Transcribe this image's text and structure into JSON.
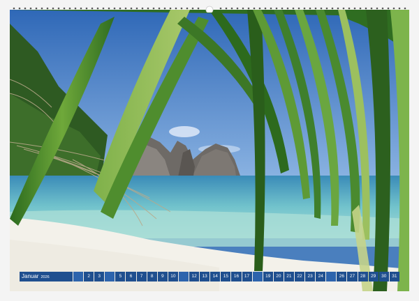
{
  "calendar": {
    "month": "Januar",
    "year": "2026",
    "days": [
      {
        "n": "",
        "we": true
      },
      {
        "n": "2"
      },
      {
        "n": "3"
      },
      {
        "n": "",
        "we": true
      },
      {
        "n": "5"
      },
      {
        "n": "6"
      },
      {
        "n": "7"
      },
      {
        "n": "8"
      },
      {
        "n": "9"
      },
      {
        "n": "10"
      },
      {
        "n": "",
        "we": true
      },
      {
        "n": "12"
      },
      {
        "n": "13"
      },
      {
        "n": "14"
      },
      {
        "n": "15"
      },
      {
        "n": "16"
      },
      {
        "n": "17"
      },
      {
        "n": "",
        "we": true
      },
      {
        "n": "19"
      },
      {
        "n": "20"
      },
      {
        "n": "21"
      },
      {
        "n": "22"
      },
      {
        "n": "23"
      },
      {
        "n": "24"
      },
      {
        "n": "",
        "we": true
      },
      {
        "n": "26"
      },
      {
        "n": "27"
      },
      {
        "n": "28"
      },
      {
        "n": "29"
      },
      {
        "n": "30"
      },
      {
        "n": "31"
      }
    ]
  },
  "colors": {
    "strip": "#1f4f8f",
    "strip_weekend": "#2d64ad",
    "sea": "#7fc8d0",
    "sand": "#f3f1ea",
    "leaf": "#3f7f2c"
  }
}
